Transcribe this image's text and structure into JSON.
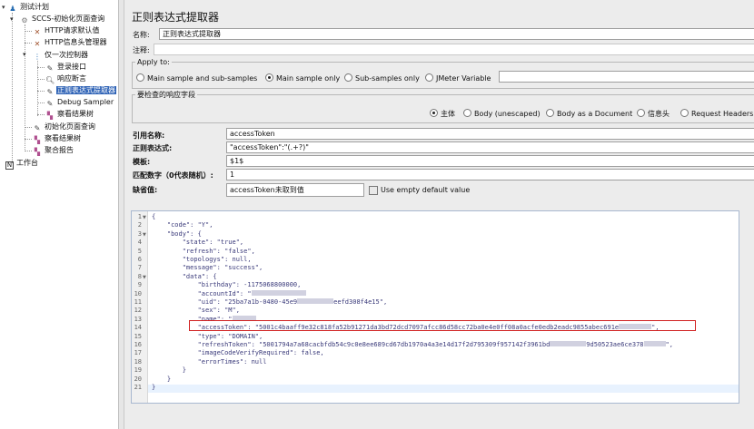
{
  "tree": {
    "plan": "测试计划",
    "group": "SCCS-初始化页面查询",
    "http_defaults": "HTTP请求默认值",
    "header_manager": "HTTP信息头管理器",
    "once_controller": "仅一次控制器",
    "login": "登录接口",
    "assertion": "响应断言",
    "regex": "正则表达式提取器",
    "debug": "Debug Sampler",
    "results_tree_inner": "察看结果树",
    "init_query": "初始化页面查询",
    "results_tree": "察看结果树",
    "aggregate": "聚合报告",
    "workbench": "工作台"
  },
  "panel": {
    "title": "正则表达式提取器",
    "name_label": "名称:",
    "name_value": "正则表达式提取器",
    "comment_label": "注释:",
    "comment_value": "",
    "apply_to_legend": "Apply to:",
    "apply_options": [
      "Main sample and sub-samples",
      "Main sample only",
      "Sub-samples only",
      "JMeter Variable"
    ],
    "apply_selected": "Main sample only",
    "jmeter_var_value": "",
    "field_legend": "要检查的响应字段",
    "field_options": [
      "主体",
      "Body (unescaped)",
      "Body as a Document",
      "信息头",
      "Request Headers"
    ],
    "field_selected": "主体",
    "ref_label": "引用名称:",
    "ref_value": "accessToken",
    "regex_label": "正则表达式:",
    "regex_value": "\"accessToken\":\"(.+?)\"",
    "template_label": "模板:",
    "template_value": "$1$",
    "match_label": "匹配数字（0代表随机）:",
    "match_value": "1",
    "default_label": "缺省值:",
    "default_value": "accessToken未取到值",
    "empty_default_label": "Use empty default value"
  },
  "editor": {
    "line_numbers": [
      "1",
      "2",
      "3",
      "4",
      "5",
      "6",
      "7",
      "8",
      "9",
      "10",
      "11",
      "12",
      "13",
      "14",
      "15",
      "16",
      "17",
      "18",
      "19",
      "20",
      "21"
    ],
    "lines": [
      "{",
      "    \"code\": \"Y\",",
      "    \"body\": {",
      "        \"state\": \"true\",",
      "        \"refresh\": \"false\",",
      "        \"topologys\": null,",
      "        \"message\": \"success\",",
      "        \"data\": {",
      "            \"birthday\": -1175068800000,",
      "            \"accountId\": \"",
      "            \"uid\": \"25ba7a1b-0480-45e9",
      "            \"sex\": \"M\",",
      "            \"name\": \"",
      "            \"accessToken\": \"5001c4baaff9e32c818fa52b91271da3bd72dcd7097afcc86d58cc72ba0e4e0ff08a0acfe0edb2eadc9855abec691e",
      "            \"type\": \"DOMAIN\",",
      "            \"refreshToken\": \"5001794a7a68cacbfdb54c9c0e8ee689cd67db1970a4a3e14d17f2d795309f957142f3961bd",
      "            \"imageCodeVerifyRequired\": false,",
      "            \"errorTimes\": null",
      "        }",
      "    }",
      "}"
    ],
    "uid_tail": "eefd308f4e15\",",
    "token_tail": "\",",
    "refresh_tail": "9d50523ae6ce378",
    "refresh_end": "\","
  }
}
